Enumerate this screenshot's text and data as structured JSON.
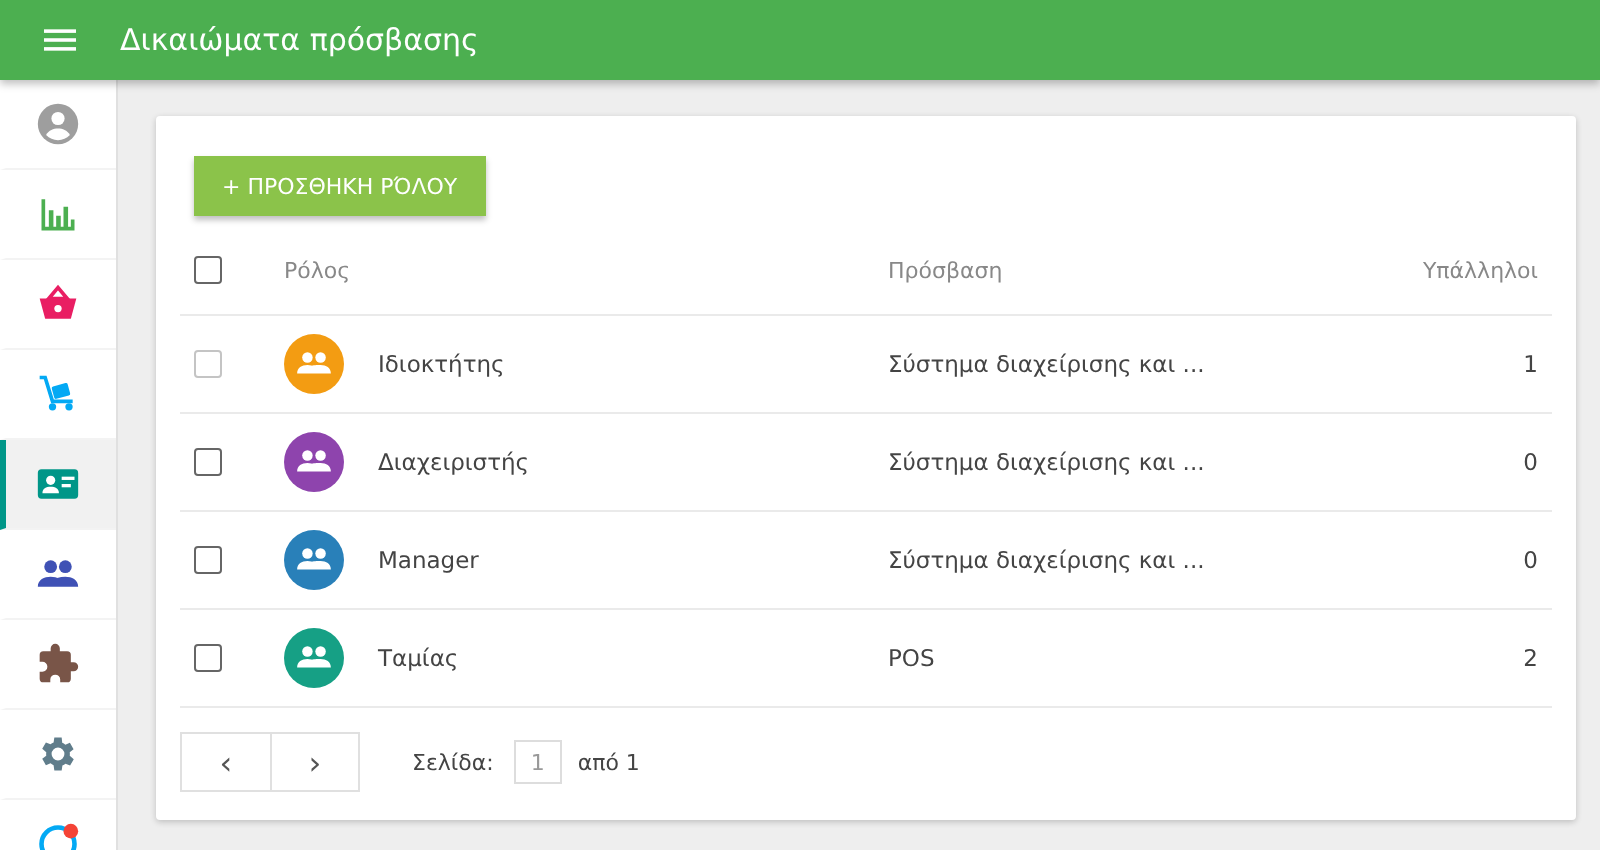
{
  "app_bar": {
    "title": "Δικαιώματα πρόσβασης"
  },
  "sidebar": {
    "items": [
      {
        "kind": "account",
        "color": "#9e9e9e",
        "selected": false,
        "badge": false
      },
      {
        "kind": "chart",
        "color": "#4caf50",
        "selected": false,
        "badge": false
      },
      {
        "kind": "basket",
        "color": "#e91e63",
        "selected": false,
        "badge": false
      },
      {
        "kind": "cart",
        "color": "#03a9f4",
        "selected": false,
        "badge": false
      },
      {
        "kind": "card",
        "color": "#009688",
        "selected": true,
        "badge": false
      },
      {
        "kind": "people",
        "color": "#3f51b5",
        "selected": false,
        "badge": false
      },
      {
        "kind": "puzzle",
        "color": "#795548",
        "selected": false,
        "badge": false
      },
      {
        "kind": "gear",
        "color": "#607d8b",
        "selected": false,
        "badge": false
      },
      {
        "kind": "help",
        "color": "#03a9f4",
        "selected": false,
        "badge": true
      }
    ]
  },
  "add_button": {
    "label": "+ ΠΡΟΣΘΗΚΗ ΡΌΛΟΥ"
  },
  "table": {
    "columns": [
      "Ρόλος",
      "Πρόσβαση",
      "Υπάλληλοι"
    ],
    "select_all": {
      "checked": false
    },
    "rows": [
      {
        "name": "Ιδιοκτήτης",
        "access": "Σύστημα διαχείρισης και ...",
        "employees": "1",
        "color": "#f39c12",
        "checked": false,
        "disabled": true
      },
      {
        "name": "Διαχειριστής",
        "access": "Σύστημα διαχείρισης και ...",
        "employees": "0",
        "color": "#8e44ad",
        "checked": false,
        "disabled": false
      },
      {
        "name": "Manager",
        "access": "Σύστημα διαχείρισης και ...",
        "employees": "0",
        "color": "#2980b9",
        "checked": false,
        "disabled": false
      },
      {
        "name": "Ταμίας",
        "access": "POS",
        "employees": "2",
        "color": "#16a085",
        "checked": false,
        "disabled": false
      }
    ]
  },
  "pagination": {
    "prev": "‹",
    "next": "›",
    "page_label": "Σελίδα:",
    "page": "1",
    "of": "από 1"
  }
}
